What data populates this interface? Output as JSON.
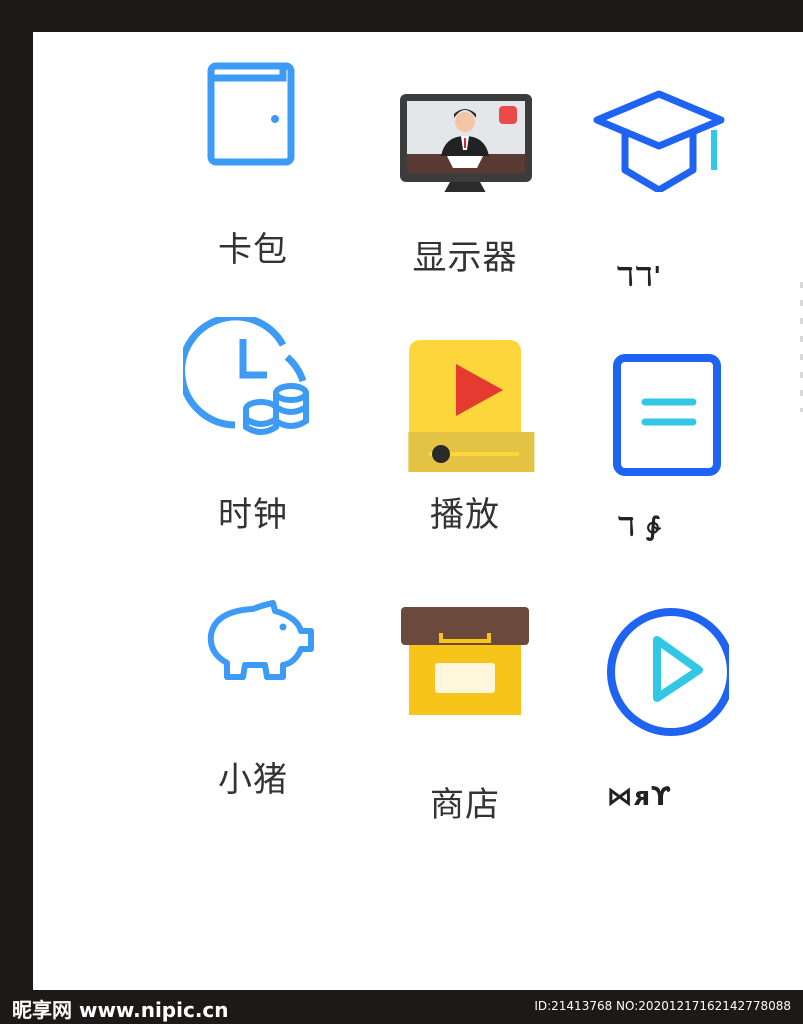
{
  "colors": {
    "icon_blue": "#3d9bf6",
    "icon_deep_blue": "#1e63f2",
    "icon_cyan": "#33c7e6",
    "yellow": "#fcd63a",
    "yellow_dark": "#e4c244",
    "red": "#e53a2f",
    "brown": "#6b4a3d",
    "label": "#333333"
  },
  "apps": [
    {
      "name": "卡包",
      "icon": "wallet-icon"
    },
    {
      "name": "显示器",
      "icon": "monitor-icon"
    },
    {
      "name": "ℸℸ'",
      "icon": "graduation-cap-icon"
    },
    {
      "name": "时钟",
      "icon": "clock-coins-icon"
    },
    {
      "name": "播放",
      "icon": "video-player-icon"
    },
    {
      "name": "ℸ ∲",
      "icon": "document-icon"
    },
    {
      "name": "小猪",
      "icon": "piggy-bank-icon"
    },
    {
      "name": "商店",
      "icon": "store-box-icon"
    },
    {
      "name": "⋈ᴙϒ",
      "icon": "play-circle-icon"
    }
  ],
  "watermark": {
    "site": "昵享网 www.nipic.cn",
    "id": "ID:21413768 NO:20201217162142778088"
  }
}
